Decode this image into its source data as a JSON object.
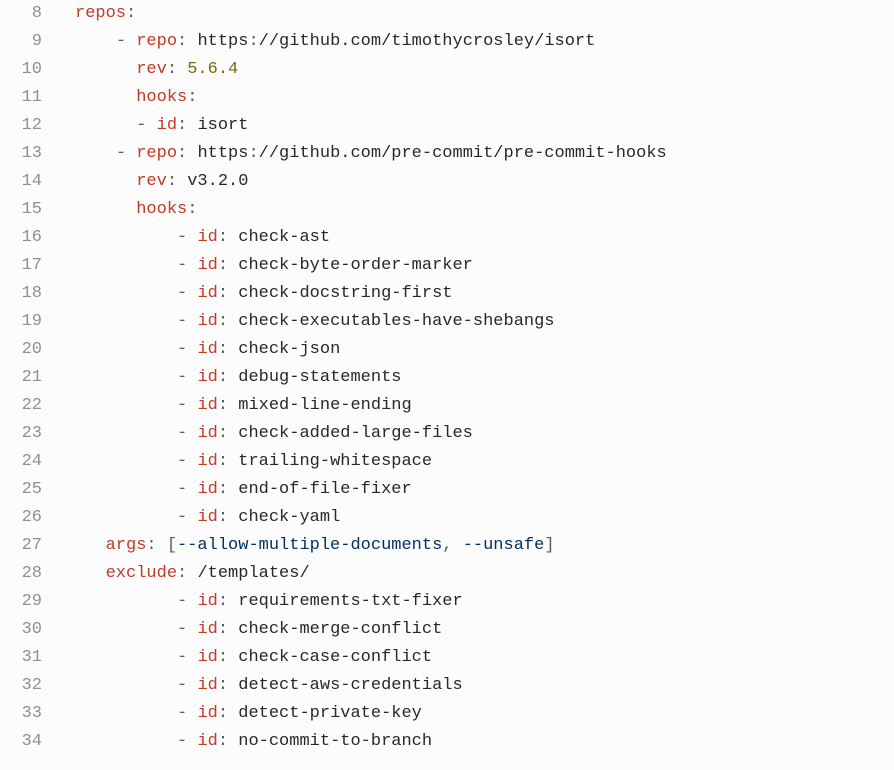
{
  "lines": [
    {
      "n": "8",
      "tokens": [
        {
          "c": "key",
          "t": "repos"
        },
        {
          "c": "punc",
          "t": ":"
        }
      ],
      "indent": 0
    },
    {
      "n": "9",
      "tokens": [
        {
          "c": "dash",
          "t": "- "
        },
        {
          "c": "key",
          "t": "repo"
        },
        {
          "c": "punc",
          "t": ": "
        },
        {
          "c": "str",
          "t": "https"
        },
        {
          "c": "punc",
          "t": ":"
        },
        {
          "c": "str",
          "t": "//github.com/timothycrosley/isort"
        }
      ],
      "indent": 4
    },
    {
      "n": "10",
      "tokens": [
        {
          "c": "key",
          "t": "rev"
        },
        {
          "c": "punc",
          "t": ": "
        },
        {
          "c": "num",
          "t": "5.6.4"
        }
      ],
      "indent": 6
    },
    {
      "n": "11",
      "tokens": [
        {
          "c": "key",
          "t": "hooks"
        },
        {
          "c": "punc",
          "t": ":"
        }
      ],
      "indent": 6
    },
    {
      "n": "12",
      "tokens": [
        {
          "c": "dash",
          "t": "- "
        },
        {
          "c": "key",
          "t": "id"
        },
        {
          "c": "punc",
          "t": ": "
        },
        {
          "c": "str",
          "t": "isort"
        }
      ],
      "indent": 6
    },
    {
      "n": "13",
      "tokens": [
        {
          "c": "dash",
          "t": "- "
        },
        {
          "c": "key",
          "t": "repo"
        },
        {
          "c": "punc",
          "t": ": "
        },
        {
          "c": "str",
          "t": "https"
        },
        {
          "c": "punc",
          "t": ":"
        },
        {
          "c": "str",
          "t": "//github.com/pre-commit/pre-commit-hooks"
        }
      ],
      "indent": 4
    },
    {
      "n": "14",
      "tokens": [
        {
          "c": "key",
          "t": "rev"
        },
        {
          "c": "punc",
          "t": ": "
        },
        {
          "c": "str",
          "t": "v3.2.0"
        }
      ],
      "indent": 6
    },
    {
      "n": "15",
      "tokens": [
        {
          "c": "key",
          "t": "hooks"
        },
        {
          "c": "punc",
          "t": ":"
        }
      ],
      "indent": 6
    },
    {
      "n": "16",
      "tokens": [
        {
          "c": "dash",
          "t": "- "
        },
        {
          "c": "key",
          "t": "id"
        },
        {
          "c": "punc",
          "t": ": "
        },
        {
          "c": "str",
          "t": "check-ast"
        }
      ],
      "indent": 10
    },
    {
      "n": "17",
      "tokens": [
        {
          "c": "dash",
          "t": "- "
        },
        {
          "c": "key",
          "t": "id"
        },
        {
          "c": "punc",
          "t": ": "
        },
        {
          "c": "str",
          "t": "check-byte-order-marker"
        }
      ],
      "indent": 10
    },
    {
      "n": "18",
      "tokens": [
        {
          "c": "dash",
          "t": "- "
        },
        {
          "c": "key",
          "t": "id"
        },
        {
          "c": "punc",
          "t": ": "
        },
        {
          "c": "str",
          "t": "check-docstring-first"
        }
      ],
      "indent": 10
    },
    {
      "n": "19",
      "tokens": [
        {
          "c": "dash",
          "t": "- "
        },
        {
          "c": "key",
          "t": "id"
        },
        {
          "c": "punc",
          "t": ": "
        },
        {
          "c": "str",
          "t": "check-executables-have-shebangs"
        }
      ],
      "indent": 10
    },
    {
      "n": "20",
      "tokens": [
        {
          "c": "dash",
          "t": "- "
        },
        {
          "c": "key",
          "t": "id"
        },
        {
          "c": "punc",
          "t": ": "
        },
        {
          "c": "str",
          "t": "check-json"
        }
      ],
      "indent": 10
    },
    {
      "n": "21",
      "tokens": [
        {
          "c": "dash",
          "t": "- "
        },
        {
          "c": "key",
          "t": "id"
        },
        {
          "c": "punc",
          "t": ": "
        },
        {
          "c": "str",
          "t": "debug-statements"
        }
      ],
      "indent": 10
    },
    {
      "n": "22",
      "tokens": [
        {
          "c": "dash",
          "t": "- "
        },
        {
          "c": "key",
          "t": "id"
        },
        {
          "c": "punc",
          "t": ": "
        },
        {
          "c": "str",
          "t": "mixed-line-ending"
        }
      ],
      "indent": 10
    },
    {
      "n": "23",
      "tokens": [
        {
          "c": "dash",
          "t": "- "
        },
        {
          "c": "key",
          "t": "id"
        },
        {
          "c": "punc",
          "t": ": "
        },
        {
          "c": "str",
          "t": "check-added-large-files"
        }
      ],
      "indent": 10
    },
    {
      "n": "24",
      "tokens": [
        {
          "c": "dash",
          "t": "- "
        },
        {
          "c": "key",
          "t": "id"
        },
        {
          "c": "punc",
          "t": ": "
        },
        {
          "c": "str",
          "t": "trailing-whitespace"
        }
      ],
      "indent": 10
    },
    {
      "n": "25",
      "tokens": [
        {
          "c": "dash",
          "t": "- "
        },
        {
          "c": "key",
          "t": "id"
        },
        {
          "c": "punc",
          "t": ": "
        },
        {
          "c": "str",
          "t": "end-of-file-fixer"
        }
      ],
      "indent": 10
    },
    {
      "n": "26",
      "tokens": [
        {
          "c": "dash",
          "t": "- "
        },
        {
          "c": "key",
          "t": "id"
        },
        {
          "c": "punc",
          "t": ": "
        },
        {
          "c": "str",
          "t": "check-yaml"
        }
      ],
      "indent": 10
    },
    {
      "n": "27",
      "tokens": [
        {
          "c": "key",
          "t": "args"
        },
        {
          "c": "punc",
          "t": ": ["
        },
        {
          "c": "arg",
          "t": "--allow-multiple-documents"
        },
        {
          "c": "punc",
          "t": ", "
        },
        {
          "c": "arg",
          "t": "--unsafe"
        },
        {
          "c": "punc",
          "t": "]"
        }
      ],
      "indent": 3
    },
    {
      "n": "28",
      "tokens": [
        {
          "c": "key",
          "t": "exclude"
        },
        {
          "c": "punc",
          "t": ": "
        },
        {
          "c": "str",
          "t": "/templates/"
        }
      ],
      "indent": 3
    },
    {
      "n": "29",
      "tokens": [
        {
          "c": "dash",
          "t": "- "
        },
        {
          "c": "key",
          "t": "id"
        },
        {
          "c": "punc",
          "t": ": "
        },
        {
          "c": "str",
          "t": "requirements-txt-fixer"
        }
      ],
      "indent": 10
    },
    {
      "n": "30",
      "tokens": [
        {
          "c": "dash",
          "t": "- "
        },
        {
          "c": "key",
          "t": "id"
        },
        {
          "c": "punc",
          "t": ": "
        },
        {
          "c": "str",
          "t": "check-merge-conflict"
        }
      ],
      "indent": 10
    },
    {
      "n": "31",
      "tokens": [
        {
          "c": "dash",
          "t": "- "
        },
        {
          "c": "key",
          "t": "id"
        },
        {
          "c": "punc",
          "t": ": "
        },
        {
          "c": "str",
          "t": "check-case-conflict"
        }
      ],
      "indent": 10
    },
    {
      "n": "32",
      "tokens": [
        {
          "c": "dash",
          "t": "- "
        },
        {
          "c": "key",
          "t": "id"
        },
        {
          "c": "punc",
          "t": ": "
        },
        {
          "c": "str",
          "t": "detect-aws-credentials"
        }
      ],
      "indent": 10
    },
    {
      "n": "33",
      "tokens": [
        {
          "c": "dash",
          "t": "- "
        },
        {
          "c": "key",
          "t": "id"
        },
        {
          "c": "punc",
          "t": ": "
        },
        {
          "c": "str",
          "t": "detect-private-key"
        }
      ],
      "indent": 10
    },
    {
      "n": "34",
      "tokens": [
        {
          "c": "dash",
          "t": "- "
        },
        {
          "c": "key",
          "t": "id"
        },
        {
          "c": "punc",
          "t": ": "
        },
        {
          "c": "str",
          "t": "no-commit-to-branch"
        }
      ],
      "indent": 10
    }
  ]
}
